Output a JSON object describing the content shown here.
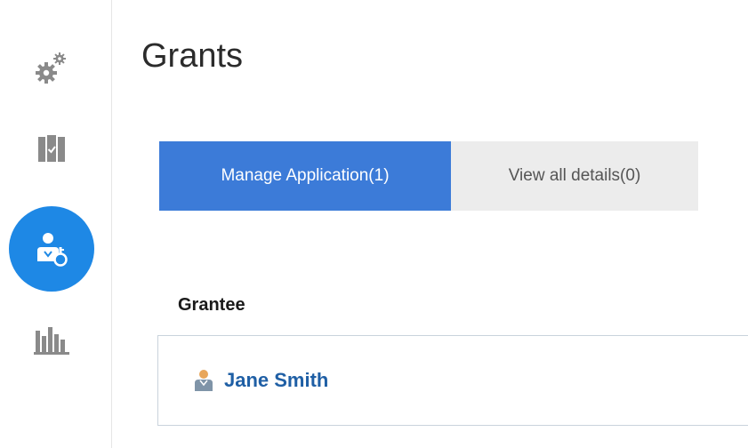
{
  "sidebar": {
    "items": [
      {
        "icon": "gears-icon",
        "active": false
      },
      {
        "icon": "map-check-icon",
        "active": false
      },
      {
        "icon": "user-key-icon",
        "active": true
      },
      {
        "icon": "bar-chart-icon",
        "active": false
      }
    ]
  },
  "page": {
    "title": "Grants"
  },
  "tabs": [
    {
      "label": "Manage Application(1)",
      "active": true
    },
    {
      "label": "View all details(0)",
      "active": false
    }
  ],
  "grantee_section": {
    "heading": "Grantee",
    "items": [
      {
        "name": "Jane Smith",
        "icon": "user-icon"
      }
    ]
  },
  "colors": {
    "accent": "#3c7bd8",
    "sidebar_active": "#1e88e5",
    "link": "#1f5fa5",
    "icon_gray": "#8a8a8a"
  }
}
